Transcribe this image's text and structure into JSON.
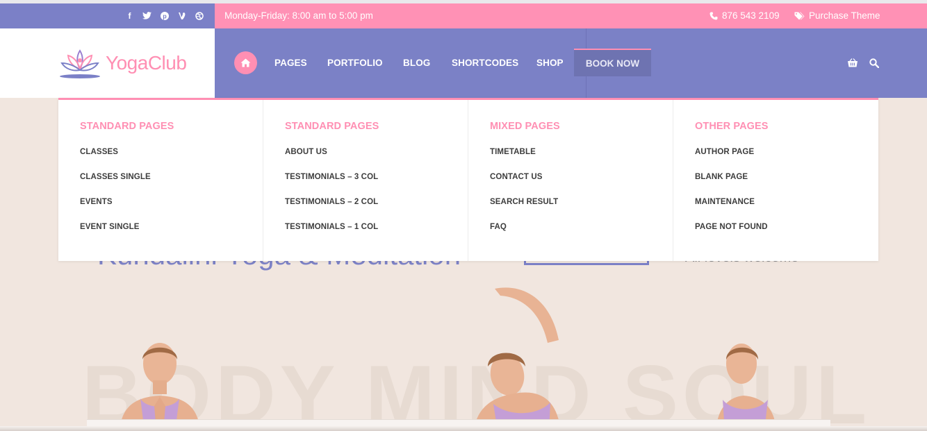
{
  "topbar": {
    "social_icons": [
      "facebook-icon",
      "twitter-icon",
      "pinterest-icon",
      "vine-icon",
      "dribbble-icon"
    ],
    "hours": "Monday-Friday: 8:00 am to 5:00 pm",
    "phone": "876 543 2109",
    "purchase": "Purchase Theme"
  },
  "logo": {
    "text": "YogaClub"
  },
  "nav": {
    "items": [
      "PAGES",
      "PORTFOLIO",
      "BLOG",
      "SHORTCODES",
      "SHOP"
    ],
    "book_now": "BOOK NOW"
  },
  "mega_menu": {
    "columns": [
      {
        "title": "STANDARD PAGES",
        "items": [
          "CLASSES",
          "CLASSES SINGLE",
          "EVENTS",
          "EVENT SINGLE"
        ]
      },
      {
        "title": "STANDARD PAGES",
        "items": [
          "ABOUT US",
          "TESTIMONIALS – 3 COL",
          "TESTIMONIALS – 2 COL",
          "TESTIMONIALS – 1 COL"
        ]
      },
      {
        "title": "MIXED PAGES",
        "items": [
          "TIMETABLE",
          "CONTACT US",
          "SEARCH RESULT",
          "FAQ"
        ]
      },
      {
        "title": "OTHER PAGES",
        "items": [
          "AUTHOR PAGE",
          "BLANK PAGE",
          "MAINTENANCE",
          "PAGE NOT FOUND"
        ]
      }
    ]
  },
  "hero": {
    "headline": "Kundalini Yoga & Meditation",
    "meta": "All levels welcome",
    "background_word": "BODY MIND SOUL"
  },
  "colors": {
    "accent_pink": "#ff91b5",
    "accent_purple": "#7b80c7"
  }
}
